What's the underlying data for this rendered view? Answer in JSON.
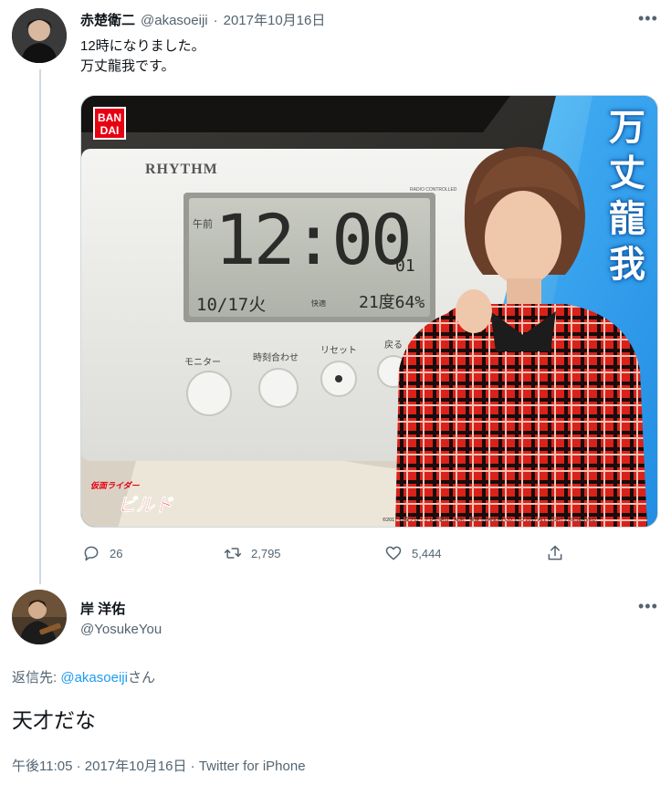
{
  "original_tweet": {
    "display_name": "赤楚衛二",
    "handle": "@akasoeiji",
    "separator": "·",
    "date": "2017年10月16日",
    "text_line1": "12時になりました。",
    "text_line2": "万丈龍我です。",
    "media": {
      "brand_logo_line1": "BAN",
      "brand_logo_line2": "DAI",
      "clock_brand": "RHYTHM",
      "clock_model_text": "RADIO CONTROLLED",
      "clock_ampm": "午前",
      "clock_time": "12:00",
      "clock_seconds": "01",
      "clock_date": "10/17火",
      "clock_temp_label": "快適",
      "clock_temp": "21度64%",
      "clock_buttons": [
        "モニター",
        "時刻合わせ",
        "リセット",
        "戻る"
      ],
      "side_banner_text": "万丈龍我",
      "show_logo_line1": "仮面ライダー",
      "show_logo_line2": "ビルド",
      "copyright": "©2017 石森プロ・テレビ朝日・ADK・東映 ©BANDAI CO.,LTD 2017 ALL RIGHTS RESERVED."
    },
    "actions": {
      "reply_count": "26",
      "retweet_count": "2,795",
      "like_count": "5,444"
    }
  },
  "reply_tweet": {
    "display_name": "岸 洋佑",
    "handle": "@YosukeYou",
    "reply_prefix": "返信先: ",
    "reply_to_handle": "@akasoeiji",
    "reply_suffix": "さん",
    "text": "天才だな",
    "timestamp": "午後11:05 · 2017年10月16日 · Twitter for iPhone"
  },
  "more_glyph": "•••",
  "colors": {
    "accent": "#1d9bf0",
    "muted": "#536471",
    "text": "#0f1419",
    "divider": "#cfd9de"
  }
}
